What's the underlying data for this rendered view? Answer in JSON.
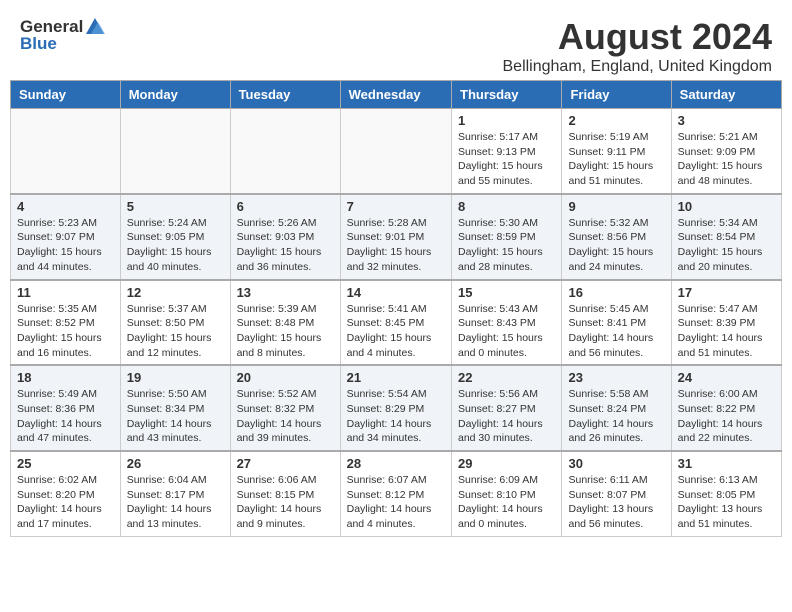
{
  "header": {
    "logo_general": "General",
    "logo_blue": "Blue",
    "month_year": "August 2024",
    "location": "Bellingham, England, United Kingdom"
  },
  "weekdays": [
    "Sunday",
    "Monday",
    "Tuesday",
    "Wednesday",
    "Thursday",
    "Friday",
    "Saturday"
  ],
  "weeks": [
    [
      {
        "day": "",
        "info": ""
      },
      {
        "day": "",
        "info": ""
      },
      {
        "day": "",
        "info": ""
      },
      {
        "day": "",
        "info": ""
      },
      {
        "day": "1",
        "info": "Sunrise: 5:17 AM\nSunset: 9:13 PM\nDaylight: 15 hours\nand 55 minutes."
      },
      {
        "day": "2",
        "info": "Sunrise: 5:19 AM\nSunset: 9:11 PM\nDaylight: 15 hours\nand 51 minutes."
      },
      {
        "day": "3",
        "info": "Sunrise: 5:21 AM\nSunset: 9:09 PM\nDaylight: 15 hours\nand 48 minutes."
      }
    ],
    [
      {
        "day": "4",
        "info": "Sunrise: 5:23 AM\nSunset: 9:07 PM\nDaylight: 15 hours\nand 44 minutes."
      },
      {
        "day": "5",
        "info": "Sunrise: 5:24 AM\nSunset: 9:05 PM\nDaylight: 15 hours\nand 40 minutes."
      },
      {
        "day": "6",
        "info": "Sunrise: 5:26 AM\nSunset: 9:03 PM\nDaylight: 15 hours\nand 36 minutes."
      },
      {
        "day": "7",
        "info": "Sunrise: 5:28 AM\nSunset: 9:01 PM\nDaylight: 15 hours\nand 32 minutes."
      },
      {
        "day": "8",
        "info": "Sunrise: 5:30 AM\nSunset: 8:59 PM\nDaylight: 15 hours\nand 28 minutes."
      },
      {
        "day": "9",
        "info": "Sunrise: 5:32 AM\nSunset: 8:56 PM\nDaylight: 15 hours\nand 24 minutes."
      },
      {
        "day": "10",
        "info": "Sunrise: 5:34 AM\nSunset: 8:54 PM\nDaylight: 15 hours\nand 20 minutes."
      }
    ],
    [
      {
        "day": "11",
        "info": "Sunrise: 5:35 AM\nSunset: 8:52 PM\nDaylight: 15 hours\nand 16 minutes."
      },
      {
        "day": "12",
        "info": "Sunrise: 5:37 AM\nSunset: 8:50 PM\nDaylight: 15 hours\nand 12 minutes."
      },
      {
        "day": "13",
        "info": "Sunrise: 5:39 AM\nSunset: 8:48 PM\nDaylight: 15 hours\nand 8 minutes."
      },
      {
        "day": "14",
        "info": "Sunrise: 5:41 AM\nSunset: 8:45 PM\nDaylight: 15 hours\nand 4 minutes."
      },
      {
        "day": "15",
        "info": "Sunrise: 5:43 AM\nSunset: 8:43 PM\nDaylight: 15 hours\nand 0 minutes."
      },
      {
        "day": "16",
        "info": "Sunrise: 5:45 AM\nSunset: 8:41 PM\nDaylight: 14 hours\nand 56 minutes."
      },
      {
        "day": "17",
        "info": "Sunrise: 5:47 AM\nSunset: 8:39 PM\nDaylight: 14 hours\nand 51 minutes."
      }
    ],
    [
      {
        "day": "18",
        "info": "Sunrise: 5:49 AM\nSunset: 8:36 PM\nDaylight: 14 hours\nand 47 minutes."
      },
      {
        "day": "19",
        "info": "Sunrise: 5:50 AM\nSunset: 8:34 PM\nDaylight: 14 hours\nand 43 minutes."
      },
      {
        "day": "20",
        "info": "Sunrise: 5:52 AM\nSunset: 8:32 PM\nDaylight: 14 hours\nand 39 minutes."
      },
      {
        "day": "21",
        "info": "Sunrise: 5:54 AM\nSunset: 8:29 PM\nDaylight: 14 hours\nand 34 minutes."
      },
      {
        "day": "22",
        "info": "Sunrise: 5:56 AM\nSunset: 8:27 PM\nDaylight: 14 hours\nand 30 minutes."
      },
      {
        "day": "23",
        "info": "Sunrise: 5:58 AM\nSunset: 8:24 PM\nDaylight: 14 hours\nand 26 minutes."
      },
      {
        "day": "24",
        "info": "Sunrise: 6:00 AM\nSunset: 8:22 PM\nDaylight: 14 hours\nand 22 minutes."
      }
    ],
    [
      {
        "day": "25",
        "info": "Sunrise: 6:02 AM\nSunset: 8:20 PM\nDaylight: 14 hours\nand 17 minutes."
      },
      {
        "day": "26",
        "info": "Sunrise: 6:04 AM\nSunset: 8:17 PM\nDaylight: 14 hours\nand 13 minutes."
      },
      {
        "day": "27",
        "info": "Sunrise: 6:06 AM\nSunset: 8:15 PM\nDaylight: 14 hours\nand 9 minutes."
      },
      {
        "day": "28",
        "info": "Sunrise: 6:07 AM\nSunset: 8:12 PM\nDaylight: 14 hours\nand 4 minutes."
      },
      {
        "day": "29",
        "info": "Sunrise: 6:09 AM\nSunset: 8:10 PM\nDaylight: 14 hours\nand 0 minutes."
      },
      {
        "day": "30",
        "info": "Sunrise: 6:11 AM\nSunset: 8:07 PM\nDaylight: 13 hours\nand 56 minutes."
      },
      {
        "day": "31",
        "info": "Sunrise: 6:13 AM\nSunset: 8:05 PM\nDaylight: 13 hours\nand 51 minutes."
      }
    ]
  ]
}
